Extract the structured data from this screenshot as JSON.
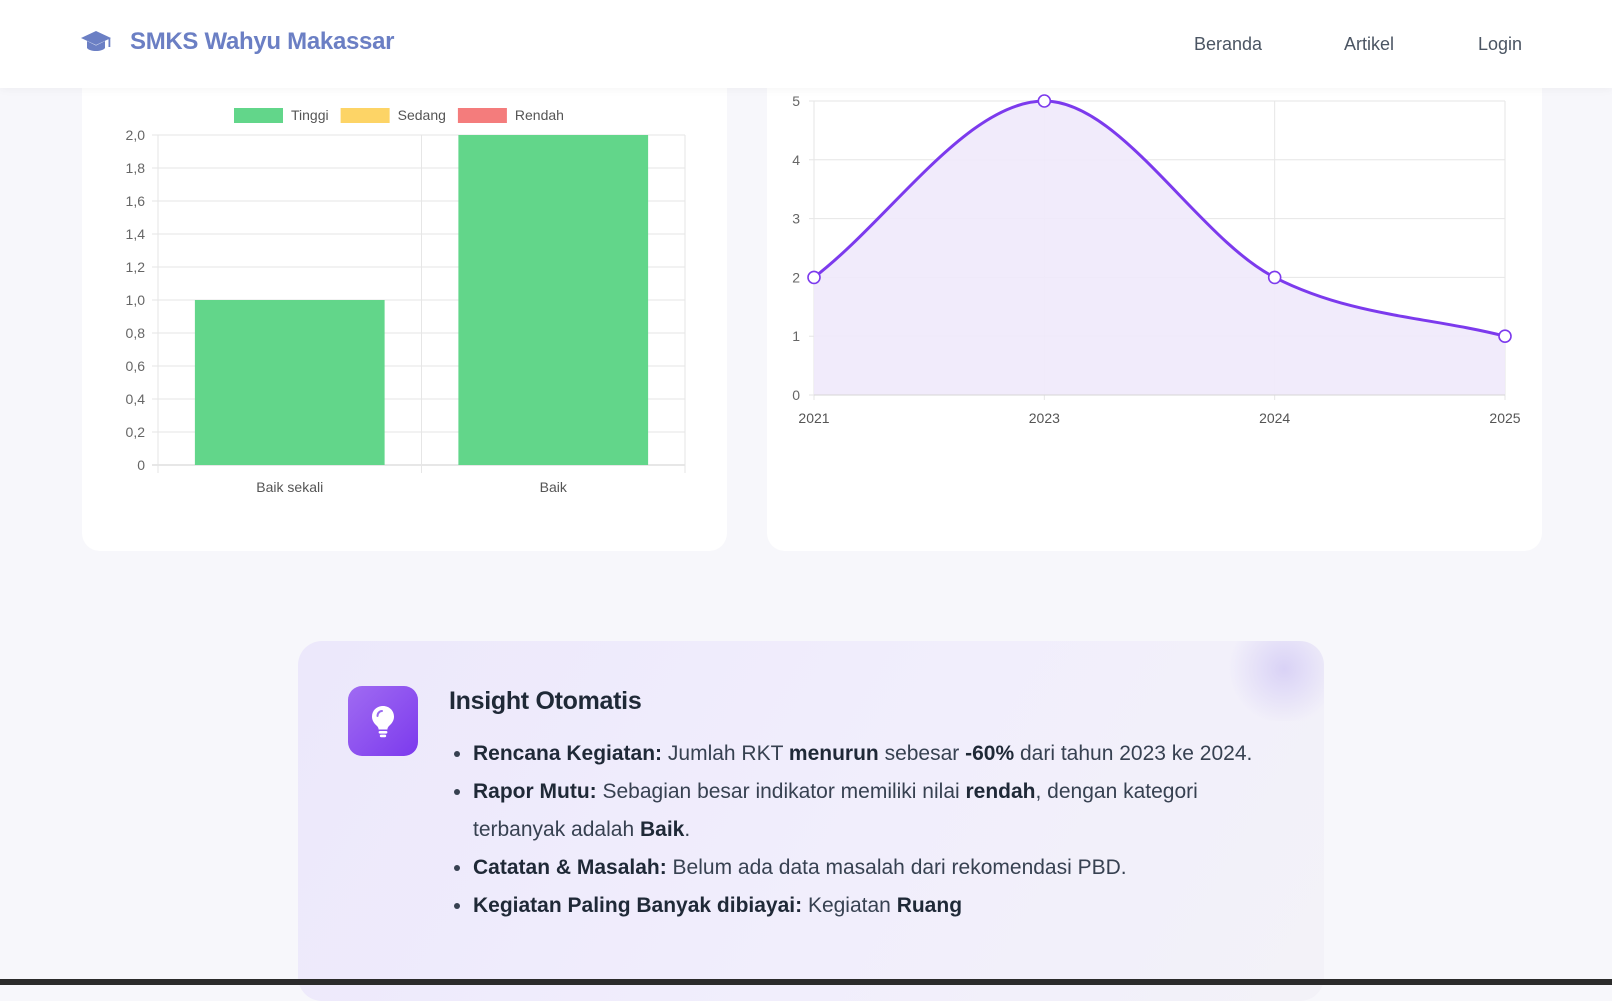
{
  "navbar": {
    "brand": "SMKS Wahyu Makassar",
    "links": [
      "Beranda",
      "Artikel",
      "Login"
    ]
  },
  "colors": {
    "brand": "#6b7fc4",
    "bar_tinggi": "#62d68a",
    "bar_sedang": "#fdd466",
    "bar_rendah": "#f47c7c",
    "line": "#7c3aed",
    "area": "#efe9fb"
  },
  "chart_data": [
    {
      "type": "bar",
      "categories": [
        "Baik sekali",
        "Baik"
      ],
      "series": [
        {
          "name": "Tinggi",
          "values": [
            1,
            2
          ]
        },
        {
          "name": "Sedang",
          "values": [
            0,
            0
          ]
        },
        {
          "name": "Rendah",
          "values": [
            0,
            0
          ]
        }
      ],
      "ylim": [
        0,
        2
      ],
      "yticks": [
        "0",
        "0,2",
        "0,4",
        "0,6",
        "0,8",
        "1,0",
        "1,2",
        "1,4",
        "1,6",
        "1,8",
        "2,0"
      ],
      "legend": "top",
      "grid": true
    },
    {
      "type": "area",
      "x": [
        "2021",
        "2023",
        "2024",
        "2025"
      ],
      "values": [
        2,
        5,
        2,
        1
      ],
      "ylim": [
        0,
        5
      ],
      "yticks": [
        "0",
        "1",
        "2",
        "3",
        "4",
        "5"
      ],
      "grid": true,
      "smooth": true
    }
  ],
  "insight": {
    "title": "Insight Otomatis",
    "items": [
      {
        "label": "Rencana Kegiatan:",
        "t1": " Jumlah RKT ",
        "b1": "menurun",
        "t2": " sebesar ",
        "b2": "-60%",
        "t3": " dari tahun 2023 ke 2024."
      },
      {
        "label": "Rapor Mutu:",
        "t1": " Sebagian besar indikator memiliki nilai ",
        "b1": "rendah",
        "t2": ", dengan kategori terbanyak adalah ",
        "b2": "Baik",
        "t3": "."
      },
      {
        "label": "Catatan & Masalah:",
        "t1": " Belum ada data masalah dari rekomendasi PBD."
      },
      {
        "label": "Kegiatan Paling Banyak dibiayai:",
        "t1": " Kegiatan ",
        "b1": "Ruang"
      }
    ]
  }
}
